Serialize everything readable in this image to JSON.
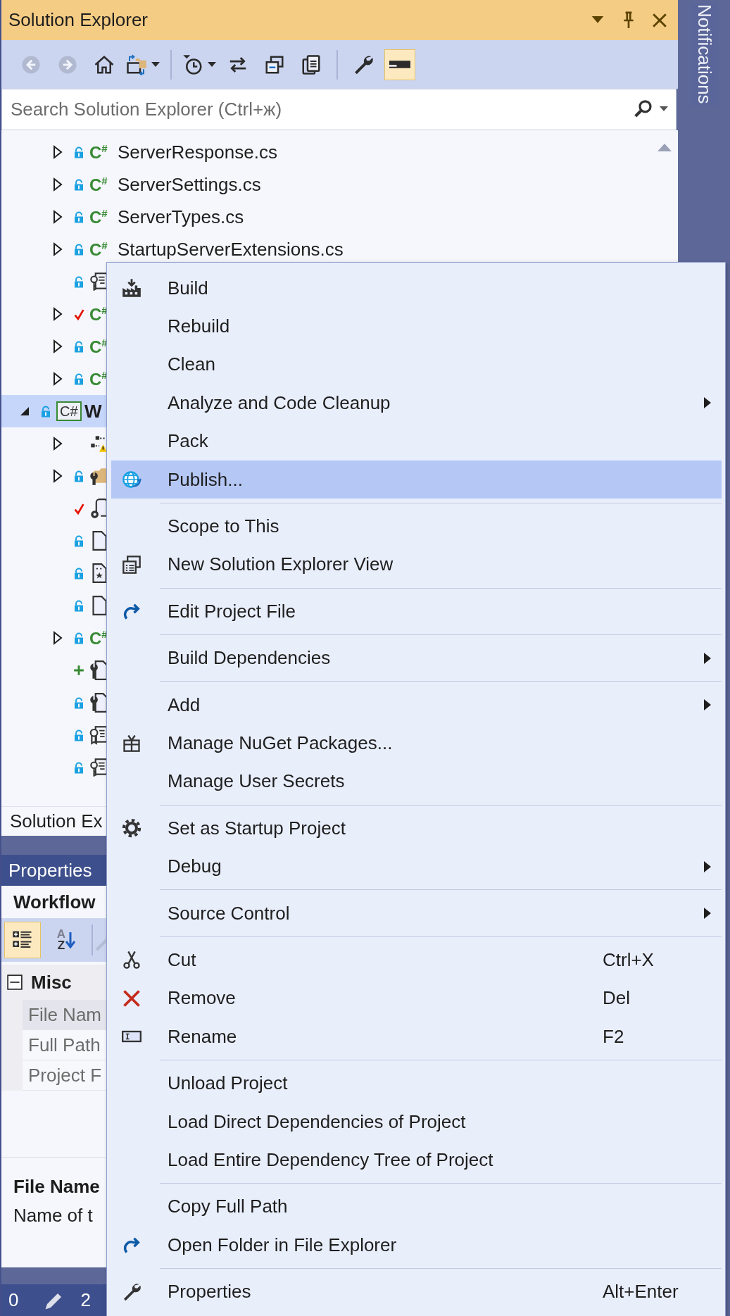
{
  "window": {
    "title": "Solution Explorer"
  },
  "toolbar": [
    [
      {
        "kind": "back",
        "disabled": true,
        "on": false,
        "dropdown": false
      },
      {
        "kind": "forward",
        "disabled": true,
        "on": false,
        "dropdown": false
      },
      {
        "kind": "home",
        "disabled": false,
        "on": false,
        "dropdown": false
      },
      {
        "kind": "switch-views",
        "disabled": false,
        "on": false,
        "dropdown": true
      }
    ],
    [
      {
        "kind": "history",
        "disabled": false,
        "on": false,
        "dropdown": true
      },
      {
        "kind": "sync",
        "disabled": false,
        "on": false,
        "dropdown": false
      },
      {
        "kind": "collapse-all",
        "disabled": false,
        "on": false,
        "dropdown": false
      },
      {
        "kind": "show-all",
        "disabled": false,
        "on": false,
        "dropdown": false
      }
    ],
    [
      {
        "kind": "properties",
        "disabled": false,
        "on": false,
        "dropdown": false
      },
      {
        "kind": "preview",
        "disabled": false,
        "on": true,
        "dropdown": false
      }
    ]
  ],
  "search": {
    "placeholder": "Search Solution Explorer (Ctrl+ж)"
  },
  "notifications": {
    "label": "Notifications"
  },
  "tree": {
    "continued_items": [
      {
        "label": "ServerResponse.cs",
        "kind": "cs",
        "icon_text": "C$^{#}$",
        "locked": true,
        "pending_edit": false,
        "pending_add": false,
        "expandable": true,
        "expanded": false,
        "selected": false
      },
      {
        "label": "ServerSettings.cs",
        "kind": "cs",
        "icon_text": "C$^{#}$",
        "locked": true,
        "pending_edit": false,
        "pending_add": false,
        "expandable": true,
        "expanded": false,
        "selected": false
      },
      {
        "label": "ServerTypes.cs",
        "kind": "cs",
        "icon_text": "C$^{#}$",
        "locked": true,
        "pending_edit": false,
        "pending_add": false,
        "expandable": true,
        "expanded": false,
        "selected": false
      },
      {
        "label": "StartupServerExtensions.cs",
        "kind": "cs",
        "icon_text": "C$^{#}$",
        "locked": true,
        "pending_edit": false,
        "pending_add": false,
        "expandable": true,
        "expanded": false,
        "selected": false
      },
      {
        "kind": "key-file",
        "locked": true,
        "pending_edit": false,
        "pending_add": false,
        "expandable": false,
        "selected": false
      },
      {
        "kind": "cs",
        "icon_text": "C$^{#}$",
        "locked": false,
        "pending_edit": true,
        "pending_add": false,
        "expandable": true,
        "expanded": false,
        "selected": false
      },
      {
        "kind": "cs",
        "icon_text": "C$^{#}$",
        "locked": true,
        "pending_edit": false,
        "pending_add": false,
        "expandable": true,
        "expanded": false,
        "selected": false
      },
      {
        "kind": "cs",
        "icon_text": "C$^{#}$",
        "locked": true,
        "pending_edit": false,
        "pending_add": false,
        "expandable": true,
        "expanded": false,
        "selected": false
      }
    ],
    "items": [
      {
        "label": "W",
        "kind": "project",
        "icon_text": "C#",
        "locked": true,
        "pending_edit": false,
        "pending_add": false,
        "expandable": true,
        "expanded": true,
        "selected": true,
        "children": [
          {
            "kind": "dependencies",
            "locked": false,
            "pending_edit": false,
            "pending_add": false,
            "expandable": true,
            "expanded": false,
            "selected": false
          },
          {
            "kind": "folder-wrench",
            "locked": true,
            "pending_edit": false,
            "pending_add": false,
            "expandable": true,
            "expanded": false,
            "selected": false
          },
          {
            "kind": "connected",
            "locked": false,
            "pending_edit": true,
            "pending_add": false,
            "expandable": false,
            "selected": false
          },
          {
            "kind": "file",
            "locked": true,
            "pending_edit": false,
            "pending_add": false,
            "expandable": false,
            "selected": false
          },
          {
            "kind": "star-file",
            "locked": true,
            "pending_edit": false,
            "pending_add": false,
            "expandable": false,
            "selected": false
          },
          {
            "kind": "file",
            "locked": true,
            "pending_edit": false,
            "pending_add": false,
            "expandable": false,
            "selected": false
          },
          {
            "kind": "cs",
            "icon_text": "C$^{#}$",
            "locked": true,
            "pending_edit": false,
            "pending_add": false,
            "expandable": true,
            "expanded": false,
            "selected": false
          },
          {
            "kind": "wrench-file",
            "locked": false,
            "pending_edit": false,
            "pending_add": true,
            "expandable": false,
            "selected": false
          },
          {
            "kind": "wrench-file",
            "locked": true,
            "pending_edit": false,
            "pending_add": false,
            "expandable": false,
            "selected": false
          },
          {
            "kind": "cert-file",
            "locked": true,
            "pending_edit": false,
            "pending_add": false,
            "expandable": false,
            "selected": false
          },
          {
            "kind": "key-file",
            "locked": true,
            "pending_edit": false,
            "pending_add": false,
            "expandable": false,
            "selected": false
          }
        ]
      }
    ]
  },
  "solution_explorer_tab": "Solution Ex",
  "properties": {
    "title": "Properties",
    "object": "Workflow",
    "toolbar": [
      {
        "kind": "categorized",
        "selected": true,
        "disabled": false
      },
      {
        "kind": "alphabetical",
        "selected": false,
        "disabled": false,
        "letters": [
          "A",
          "Z"
        ]
      },
      {
        "kind": "property-pages",
        "selected": false,
        "disabled": true
      }
    ],
    "category": {
      "label": "Misc",
      "expanded": true
    },
    "rows": [
      {
        "name": "File Nam",
        "selected": true
      },
      {
        "name": "Full Path",
        "selected": false
      },
      {
        "name": "Project F",
        "selected": false
      }
    ],
    "description": {
      "title": "File Name",
      "text": "Name of t"
    }
  },
  "status_bar": {
    "text_1": "0",
    "text_2": "2"
  },
  "context_menu": [
    {
      "kind": "build",
      "label": "Build",
      "submenu": false,
      "selected": false
    },
    {
      "kind": "plain",
      "label": "Rebuild",
      "submenu": false,
      "selected": false
    },
    {
      "kind": "plain",
      "label": "Clean",
      "submenu": false,
      "selected": false
    },
    {
      "kind": "plain",
      "label": "Analyze and Code Cleanup",
      "submenu": true,
      "selected": false
    },
    {
      "kind": "plain",
      "label": "Pack",
      "submenu": false,
      "selected": false
    },
    {
      "kind": "publish",
      "label": "Publish...",
      "submenu": false,
      "selected": true
    },
    {
      "kind": "separator"
    },
    {
      "kind": "plain",
      "label": "Scope to This",
      "submenu": false,
      "selected": false
    },
    {
      "kind": "new-view",
      "label": "New Solution Explorer View",
      "submenu": false,
      "selected": false
    },
    {
      "kind": "separator"
    },
    {
      "kind": "redo",
      "label": "Edit Project File",
      "submenu": false,
      "selected": false
    },
    {
      "kind": "separator"
    },
    {
      "kind": "plain",
      "label": "Build Dependencies",
      "submenu": true,
      "selected": false
    },
    {
      "kind": "separator"
    },
    {
      "kind": "plain",
      "label": "Add",
      "submenu": true,
      "selected": false
    },
    {
      "kind": "gift",
      "label": "Manage NuGet Packages...",
      "submenu": false,
      "selected": false
    },
    {
      "kind": "plain",
      "label": "Manage User Secrets",
      "submenu": false,
      "selected": false
    },
    {
      "kind": "separator"
    },
    {
      "kind": "gear",
      "label": "Set as Startup Project",
      "submenu": false,
      "selected": false
    },
    {
      "kind": "plain",
      "label": "Debug",
      "submenu": true,
      "selected": false
    },
    {
      "kind": "separator"
    },
    {
      "kind": "plain",
      "label": "Source Control",
      "submenu": true,
      "selected": false
    },
    {
      "kind": "separator"
    },
    {
      "kind": "scissors",
      "label": "Cut",
      "shortcut": "Ctrl+X",
      "submenu": false,
      "selected": false
    },
    {
      "kind": "remove",
      "label": "Remove",
      "shortcut": "Del",
      "submenu": false,
      "selected": false
    },
    {
      "kind": "rename",
      "label": "Rename",
      "shortcut": "F2",
      "submenu": false,
      "selected": false
    },
    {
      "kind": "separator"
    },
    {
      "kind": "plain",
      "label": "Unload Project",
      "submenu": false,
      "selected": false
    },
    {
      "kind": "plain",
      "label": "Load Direct Dependencies of Project",
      "submenu": false,
      "selected": false
    },
    {
      "kind": "plain",
      "label": "Load Entire Dependency Tree of Project",
      "submenu": false,
      "selected": false
    },
    {
      "kind": "separator"
    },
    {
      "kind": "plain",
      "label": "Copy Full Path",
      "submenu": false,
      "selected": false
    },
    {
      "kind": "redo",
      "label": "Open Folder in File Explorer",
      "submenu": false,
      "selected": false
    },
    {
      "kind": "separator"
    },
    {
      "kind": "wrench",
      "label": "Properties",
      "shortcut": "Alt+Enter",
      "submenu": false,
      "selected": false
    }
  ]
}
